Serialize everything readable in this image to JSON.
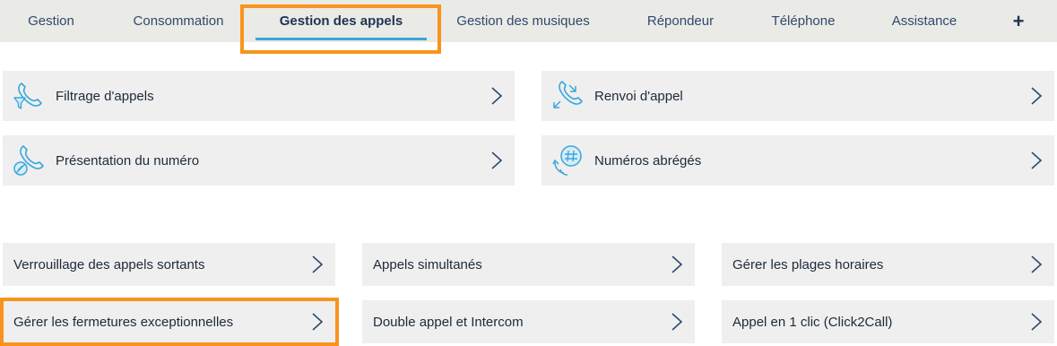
{
  "tabs": [
    {
      "label": "Gestion"
    },
    {
      "label": "Consommation"
    },
    {
      "label": "Gestion des appels"
    },
    {
      "label": "Gestion des musiques"
    },
    {
      "label": "Répondeur"
    },
    {
      "label": "Téléphone"
    },
    {
      "label": "Assistance"
    },
    {
      "label": "+"
    }
  ],
  "active_tab": "Gestion des appels",
  "colors": {
    "highlight": "#f7941d",
    "tab_underline": "#3aa6dc",
    "icon": "#3aa6dc"
  },
  "features": [
    {
      "label": "Filtrage d'appels",
      "icon": "phone-filter-icon"
    },
    {
      "label": "Renvoi d'appel",
      "icon": "call-forward-icon"
    },
    {
      "label": "Présentation du numéro",
      "icon": "number-presentation-icon"
    },
    {
      "label": "Numéros abrégés",
      "icon": "speed-dial-icon"
    }
  ],
  "options": [
    {
      "label": "Verrouillage des appels sortants"
    },
    {
      "label": "Appels simultanés"
    },
    {
      "label": "Gérer les plages horaires"
    },
    {
      "label": "Gérer les fermetures exceptionnelles"
    },
    {
      "label": "Double appel et Intercom"
    },
    {
      "label": "Appel en 1 clic (Click2Call)"
    }
  ]
}
